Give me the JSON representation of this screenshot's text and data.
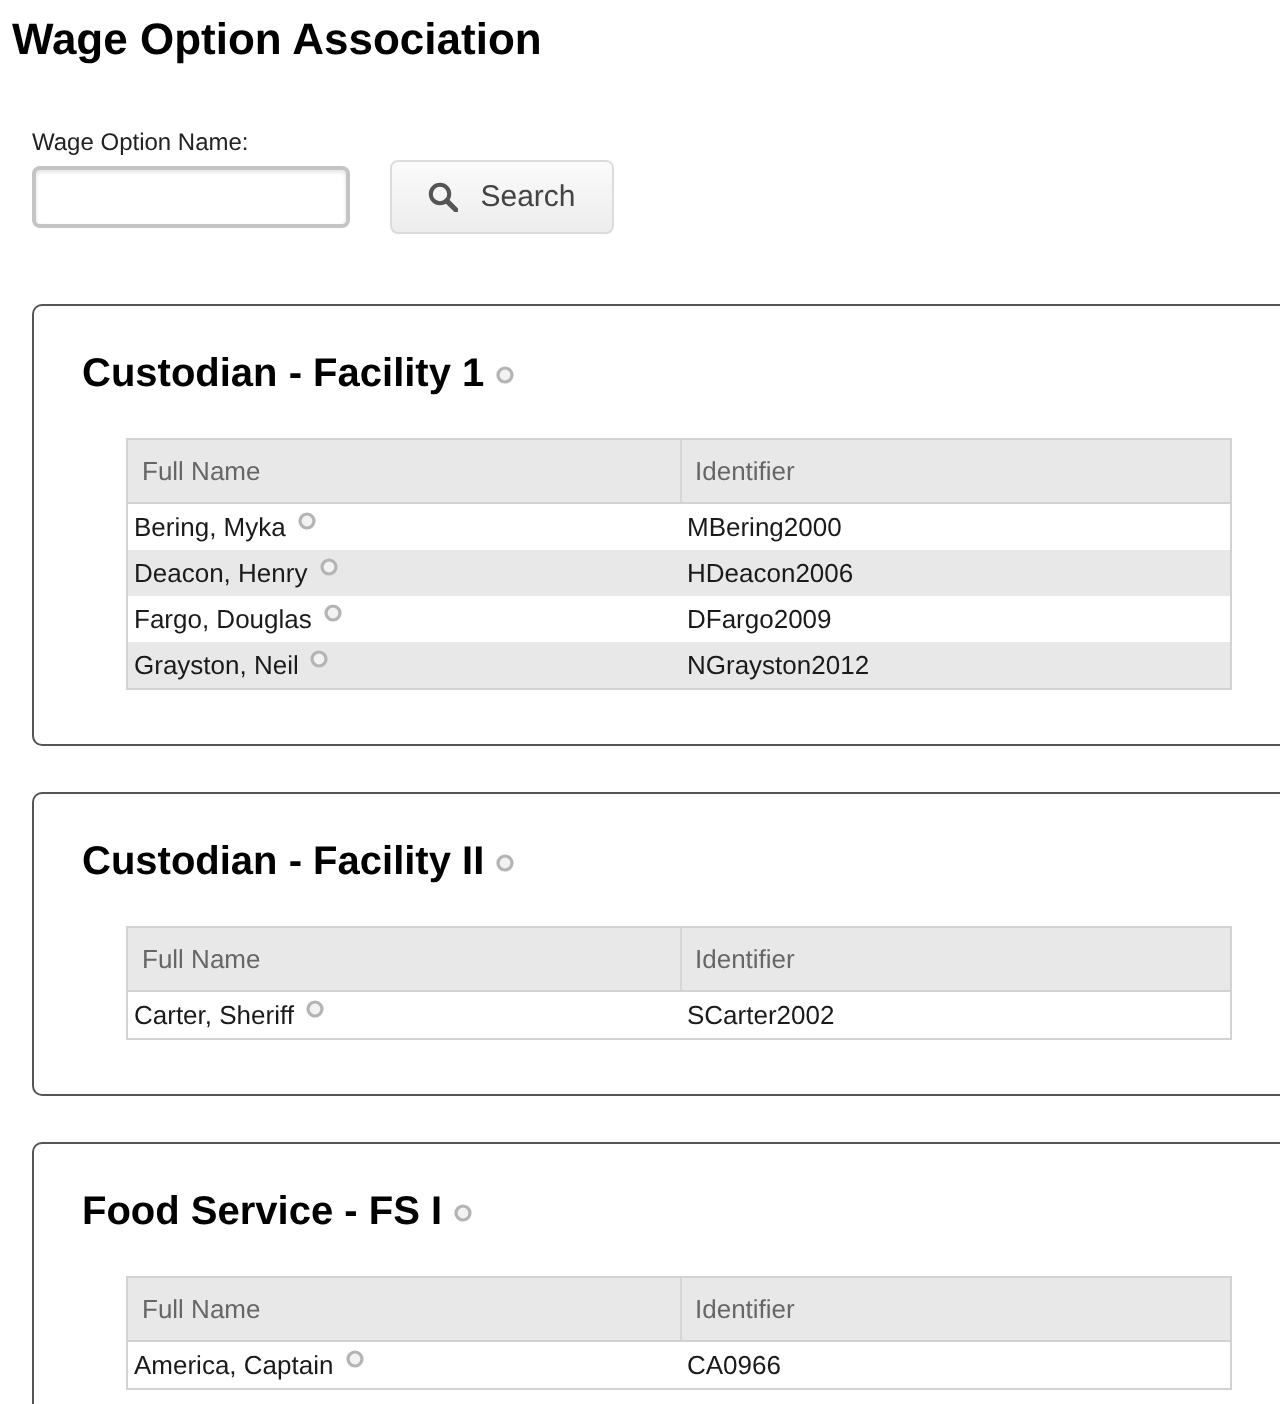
{
  "page": {
    "title": "Wage Option Association"
  },
  "search": {
    "label": "Wage Option Name:",
    "button": "Search"
  },
  "groups": [
    {
      "title": "Custodian - Facility 1",
      "columns": [
        "Full Name",
        "Identifier"
      ],
      "rows": [
        {
          "full_name": "Bering, Myka",
          "identifier": "MBering2000"
        },
        {
          "full_name": "Deacon, Henry",
          "identifier": "HDeacon2006"
        },
        {
          "full_name": "Fargo, Douglas",
          "identifier": "DFargo2009"
        },
        {
          "full_name": "Grayston, Neil",
          "identifier": "NGrayston2012"
        }
      ]
    },
    {
      "title": "Custodian - Facility II",
      "columns": [
        "Full Name",
        "Identifier"
      ],
      "rows": [
        {
          "full_name": "Carter, Sheriff",
          "identifier": "SCarter2002"
        }
      ]
    },
    {
      "title": "Food Service - FS I",
      "columns": [
        "Full Name",
        "Identifier"
      ],
      "rows": [
        {
          "full_name": "America, Captain",
          "identifier": "CA0966"
        }
      ]
    }
  ]
}
